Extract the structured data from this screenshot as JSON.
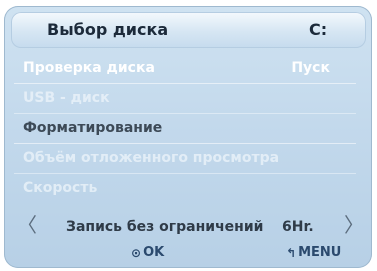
{
  "header": {
    "title": "Выбор диска",
    "drive": "C:"
  },
  "menu": {
    "items": [
      {
        "label": "Проверка диска",
        "value": "Пуск",
        "state": "enabled"
      },
      {
        "label": "USB - диск",
        "value": "",
        "state": "disabled"
      },
      {
        "label": "Форматирование",
        "value": "",
        "state": "selected"
      },
      {
        "label": "Объём отложенного просмотра",
        "value": "",
        "state": "disabled"
      },
      {
        "label": "Скорость",
        "value": "",
        "state": "disabled"
      }
    ]
  },
  "recording": {
    "left_arrow": "〈",
    "label": "Запись без ограничений",
    "value": "6Hr.",
    "right_arrow": "〉"
  },
  "footer": {
    "ok_icon": "⊙",
    "ok_label": "OK",
    "menu_icon": "↰",
    "menu_label": "MENU"
  }
}
